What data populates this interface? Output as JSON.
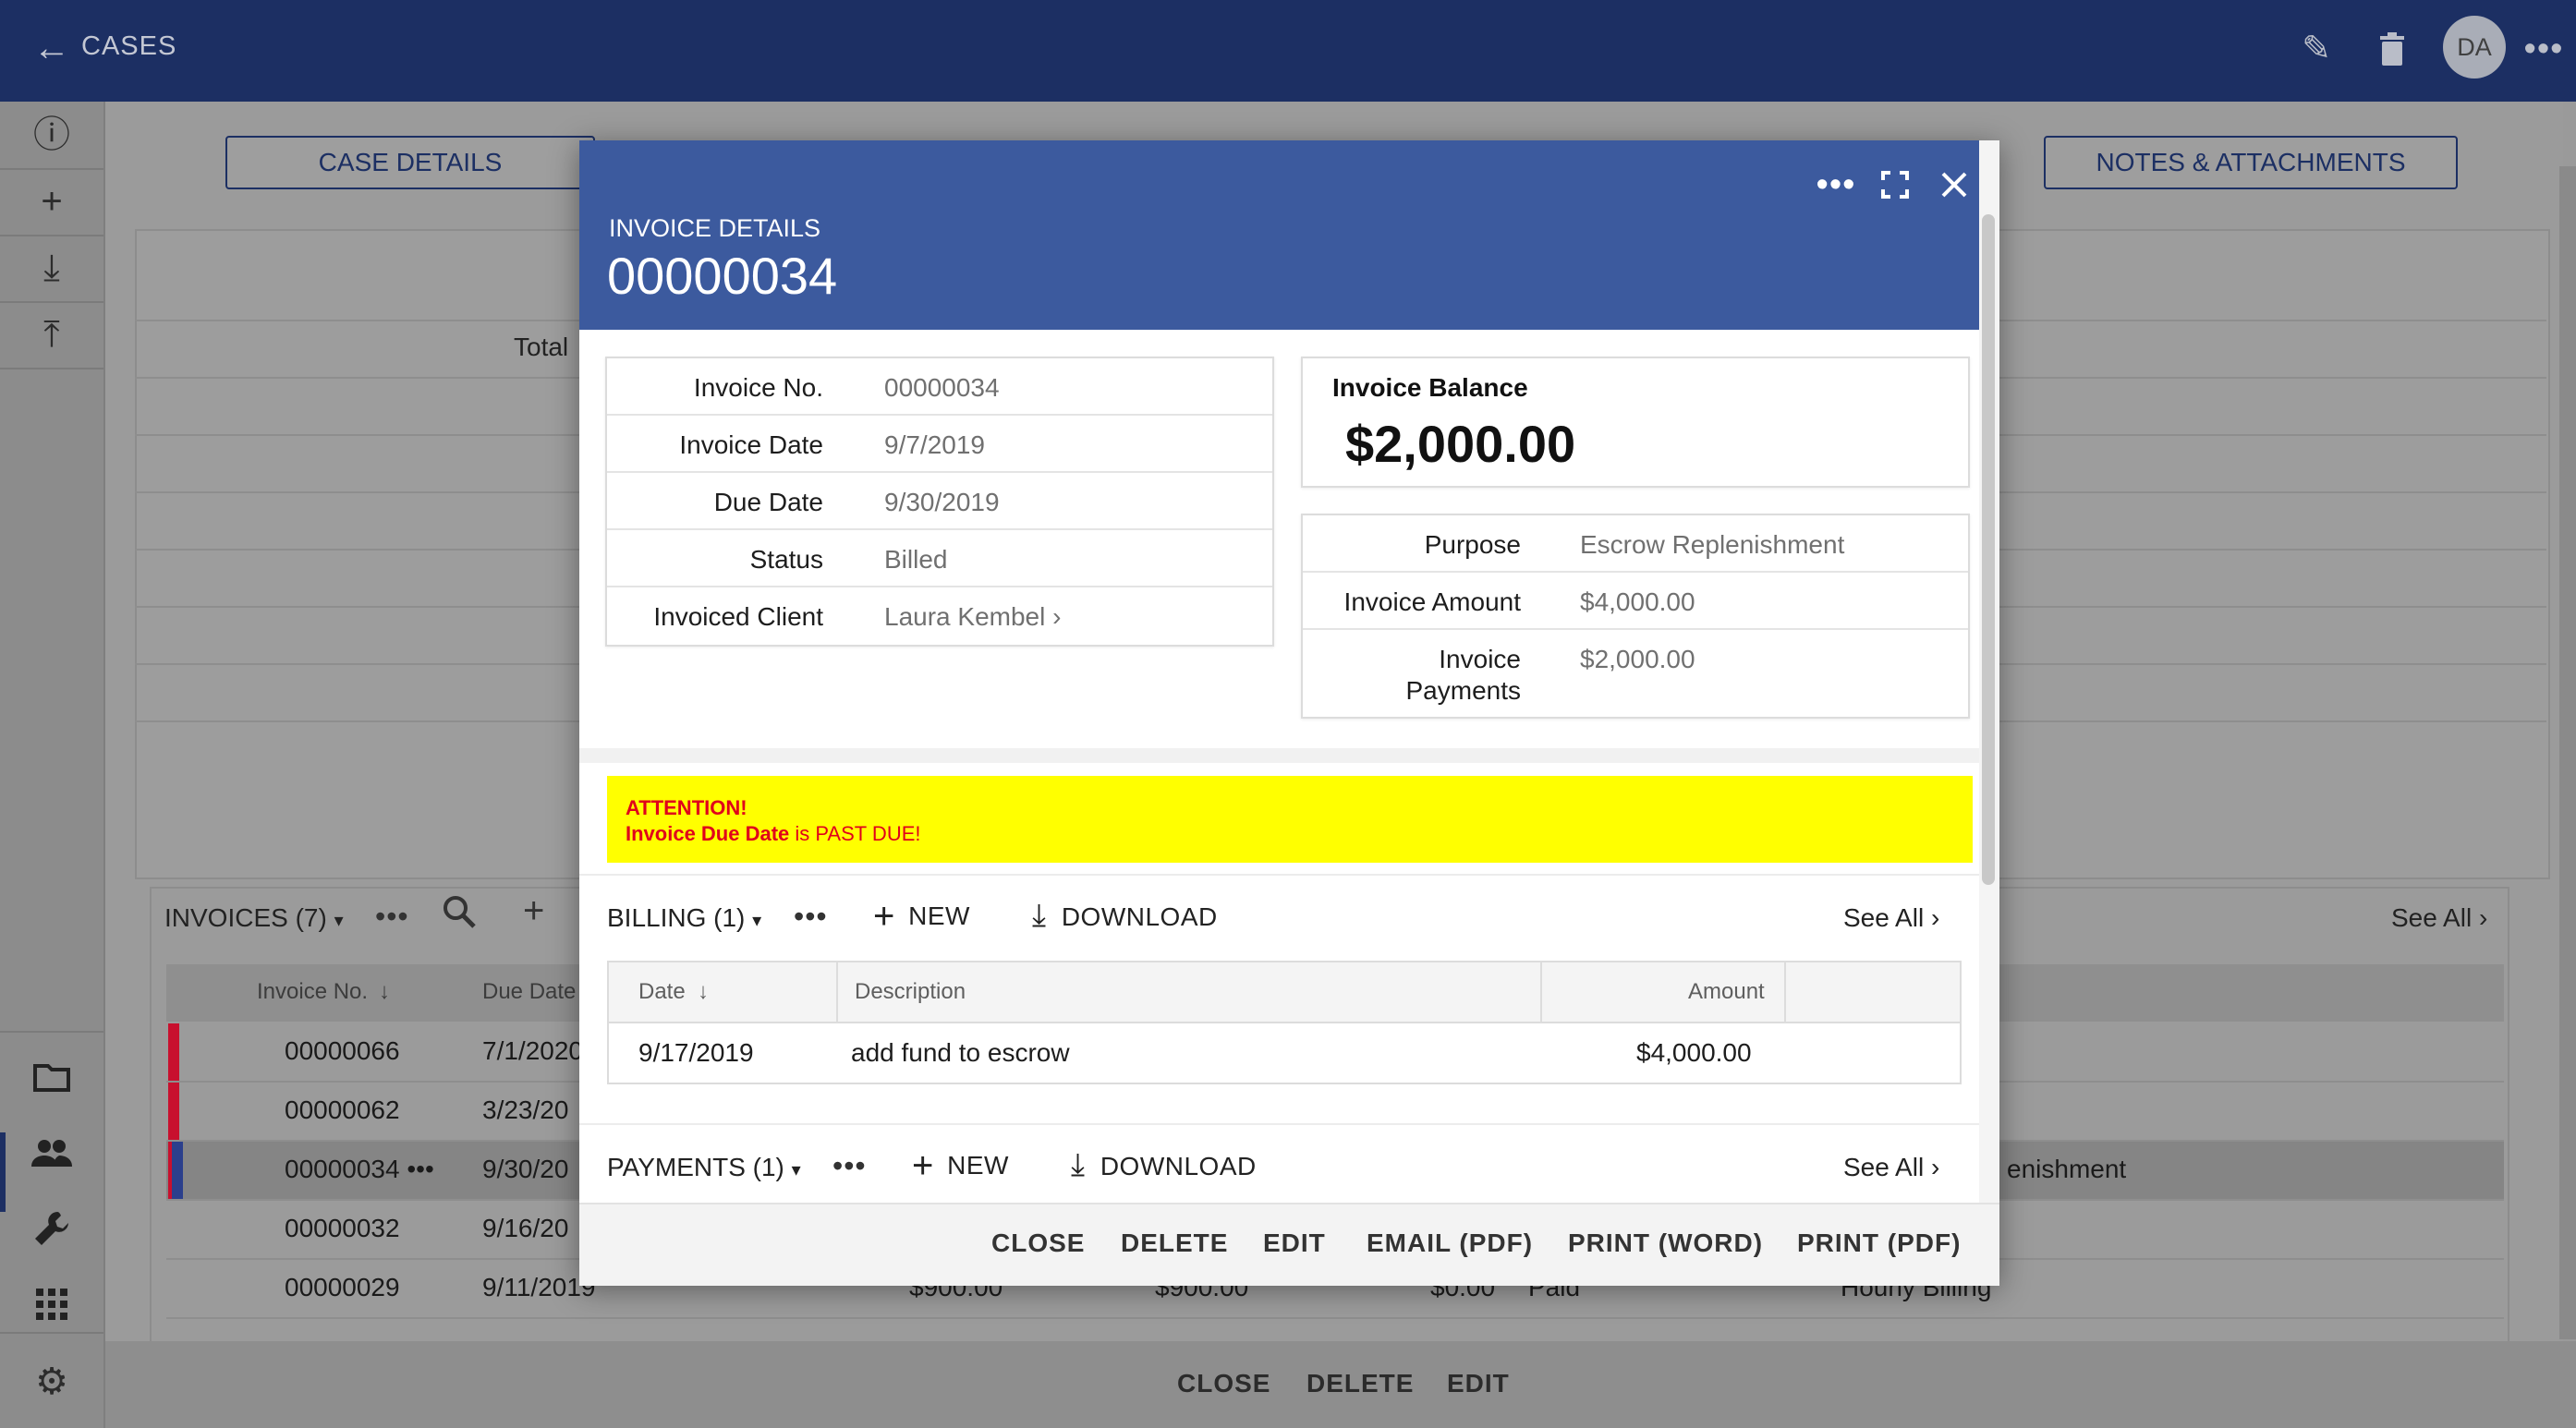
{
  "topbar": {
    "title": "CASES",
    "avatar": "DA"
  },
  "tabs": {
    "case_details": "CASE DETAILS",
    "notes": "NOTES & ATTACHMENTS"
  },
  "bg": {
    "total_label": "Total",
    "invoices_title": "INVOICES (7)",
    "see_all": "See All",
    "columns": {
      "invoice_no": "Invoice No.",
      "due_date": "Due Date"
    },
    "rows": [
      {
        "no": "00000066",
        "due": "7/1/2020",
        "flag": "#c8102e"
      },
      {
        "no": "00000062",
        "due": "3/23/20",
        "flag": "#c8102e"
      },
      {
        "no": "00000034 •••",
        "due": "9/30/20",
        "flag": "#2b3f8c",
        "extra": "enishment"
      },
      {
        "no": "00000032",
        "due": "9/16/20",
        "flag": ""
      },
      {
        "no": "00000029",
        "due": "9/11/2019",
        "amt1": "$900.00",
        "amt2": "$900.00",
        "amt3": "$0.00",
        "status": "Paid",
        "purpose": "Hourly Billing",
        "flag": ""
      }
    ],
    "bottom_actions": {
      "close": "CLOSE",
      "delete": "DELETE",
      "edit": "EDIT"
    }
  },
  "modal": {
    "eyebrow": "INVOICE DETAILS",
    "number": "00000034",
    "details": [
      {
        "label": "Invoice No.",
        "value": "00000034"
      },
      {
        "label": "Invoice Date",
        "value": "9/7/2019"
      },
      {
        "label": "Due Date",
        "value": "9/30/2019"
      },
      {
        "label": "Status",
        "value": "Billed"
      },
      {
        "label": "Invoiced Client",
        "value": "Laura Kembel"
      }
    ],
    "balance_label": "Invoice Balance",
    "balance_value": "$2,000.00",
    "summary": [
      {
        "label": "Purpose",
        "value": "Escrow Replenishment"
      },
      {
        "label": "Invoice Amount",
        "value": "$4,000.00"
      },
      {
        "label": "Invoice",
        "label2": "Payments",
        "value": "$2,000.00"
      }
    ],
    "alert": {
      "title": "ATTENTION!",
      "strong": "Invoice Due Date",
      "rest": " is PAST DUE!"
    },
    "billing": {
      "title": "BILLING (1)",
      "new": "NEW",
      "download": "DOWNLOAD",
      "see_all": "See All",
      "columns": {
        "date": "Date",
        "description": "Description",
        "amount": "Amount"
      },
      "row": {
        "date": "9/17/2019",
        "description": "add fund to escrow",
        "amount": "$4,000.00"
      }
    },
    "payments": {
      "title": "PAYMENTS (1)",
      "new": "NEW",
      "download": "DOWNLOAD",
      "see_all": "See All"
    },
    "footer": {
      "close": "CLOSE",
      "delete": "DELETE",
      "edit": "EDIT",
      "email": "EMAIL (PDF)",
      "print_word": "PRINT (WORD)",
      "print_pdf": "PRINT (PDF)"
    }
  },
  "colors": {
    "header": "#1c2f63",
    "modal_header": "#3c5a9e",
    "alert_bg": "#ffff00",
    "alert_text": "#e0001b"
  }
}
